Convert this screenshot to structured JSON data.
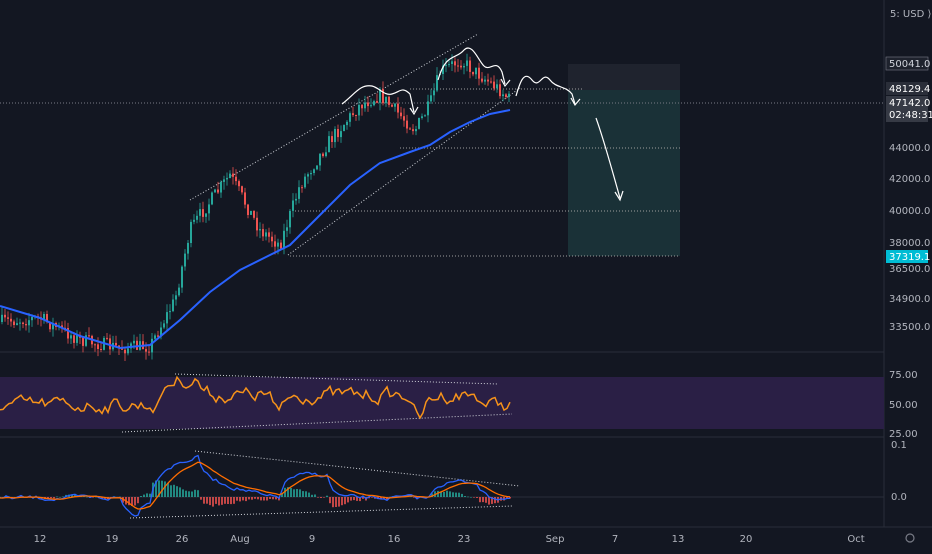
{
  "currency": "USD",
  "scale_label": "5:",
  "colors": {
    "background": "#131722",
    "candle_up": "#26a69a",
    "candle_down": "#ef5350",
    "ma_line": "#2962ff",
    "rsi_line": "#f7931a",
    "rsi_band": "#2a1f45",
    "macd_line": "#2962ff",
    "signal_line": "#ff6d00",
    "hist_up": "#26a69a",
    "hist_down": "#ef5350",
    "projection_box": "#1e3b3f",
    "target_tag": "#00bcd4",
    "annotation": "#ffffff"
  },
  "price_axis": {
    "ticks": [
      "50041.0",
      "44000.0",
      "42000.0",
      "40000.0",
      "38000.0",
      "36500.0",
      "34900.0",
      "33500.0"
    ],
    "current_price": "47142.0",
    "countdown": "02:48:31",
    "level_high": "48129.4",
    "target": "37319.1"
  },
  "rsi_axis": {
    "ticks": [
      "75.00",
      "50.00",
      "25.00"
    ]
  },
  "macd_axis": {
    "ticks": [
      "0.1",
      "0.0"
    ]
  },
  "time_axis": {
    "labels": [
      "12",
      "19",
      "26",
      "Aug",
      "9",
      "16",
      "23",
      "Sep",
      "7",
      "13",
      "20",
      "Oct"
    ]
  },
  "chart_data": {
    "type": "candlestick",
    "price_range": [
      31500,
      54300
    ],
    "x_domain_days": [
      "Jul 10",
      "Oct 1"
    ],
    "levels": {
      "resistance_box_top": 50041.0,
      "level_48129": 48129.4,
      "current": 47142.0,
      "level_44000": 44000.0,
      "level_40000": 40000.0,
      "target": 37319.1
    },
    "rsi_range": [
      20,
      100
    ],
    "rsi_levels": [
      75,
      50,
      25
    ],
    "macd_levels": [
      0.1,
      0.0
    ]
  }
}
